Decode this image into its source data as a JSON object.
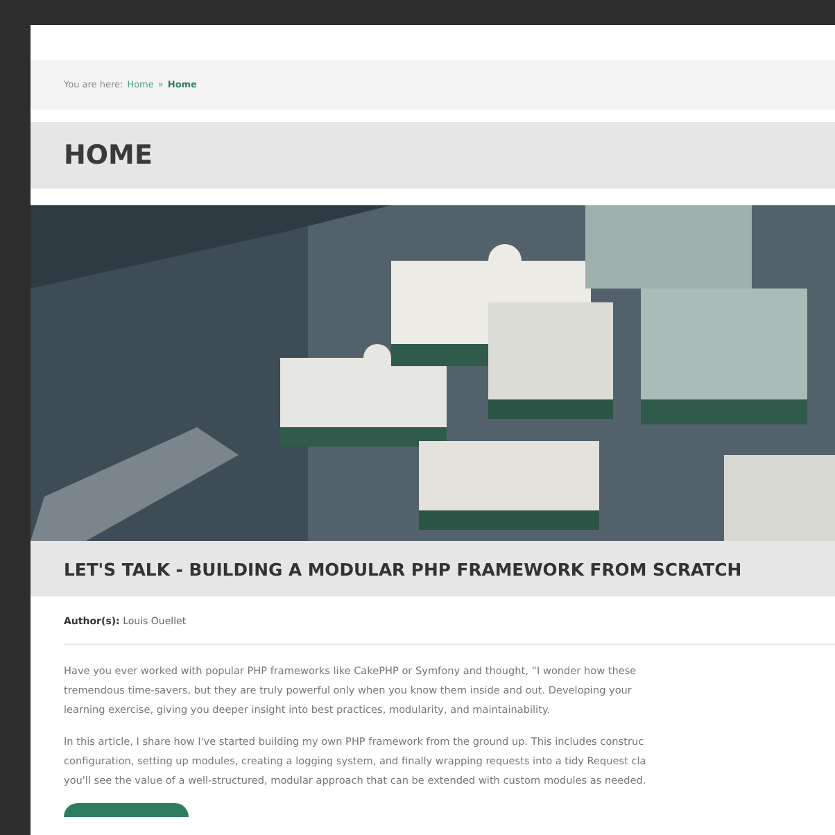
{
  "breadcrumb": {
    "prefix": "You are here:",
    "links": [
      {
        "label": "Home",
        "current": false
      },
      {
        "label": "Home",
        "current": true
      }
    ],
    "separator": "»"
  },
  "page_title": "HOME",
  "article": {
    "title": "LET'S TALK - BUILDING A MODULAR PHP FRAMEWORK FROM SCRATCH",
    "author_label": "Author(s):",
    "author": "Louis Ouellet",
    "paragraphs": [
      [
        "Have you ever worked with popular PHP frameworks like CakePHP or Symfony and thought, “I wonder how these",
        "tremendous time-savers, but they are truly powerful only when you know them inside and out. Developing your",
        "learning exercise, giving you deeper insight into best practices, modularity, and maintainability."
      ],
      [
        "In this article, I share how I've started building my own PHP framework from the ground up. This includes construc",
        "configuration, setting up modules, creating a logging system, and finally wrapping requests into a tidy Request cla",
        "you'll see the value of a well-structured, modular approach that can be extended with custom modules as needed."
      ]
    ]
  }
}
